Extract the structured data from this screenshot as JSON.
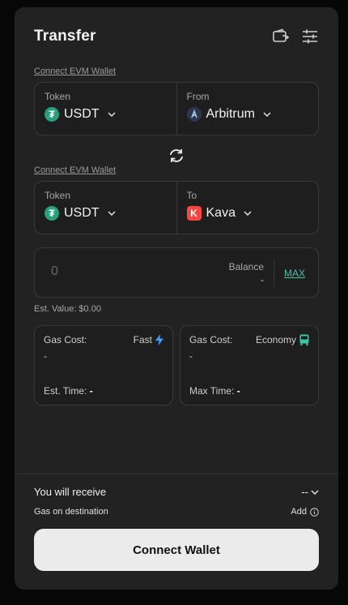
{
  "header": {
    "title": "Transfer",
    "icons": [
      "wallet-add-icon",
      "settings-sliders-icon"
    ]
  },
  "source": {
    "connect_label": "Connect EVM Wallet",
    "token_label": "Token",
    "token_value": "USDT",
    "chain_label": "From",
    "chain_value": "Arbitrum"
  },
  "destination": {
    "connect_label": "Connect EVM Wallet",
    "token_label": "Token",
    "token_value": "USDT",
    "chain_label": "To",
    "chain_value": "Kava"
  },
  "amount": {
    "placeholder": "0",
    "balance_label": "Balance",
    "balance_value": "-",
    "max_label": "MAX",
    "est_value": "Est. Value: $0.00"
  },
  "gas_options": [
    {
      "cost_label": "Gas Cost:",
      "speed": "Fast",
      "cost_value": "-",
      "time_label": "Est. Time:",
      "time_value": "-"
    },
    {
      "cost_label": "Gas Cost:",
      "speed": "Economy",
      "cost_value": "-",
      "time_label": "Max Time:",
      "time_value": "-"
    }
  ],
  "summary": {
    "receive_label": "You will receive",
    "receive_value": "--",
    "gas_dest_label": "Gas on destination",
    "add_label": "Add"
  },
  "action": {
    "connect_wallet": "Connect Wallet"
  },
  "colors": {
    "accent": "#3ec6a8",
    "fast_icon": "#3aa0ff",
    "economy_icon": "#3ec6a8",
    "usdt": "#26a17b",
    "kava": "#ff433e",
    "arbitrum": "#2d374b"
  }
}
